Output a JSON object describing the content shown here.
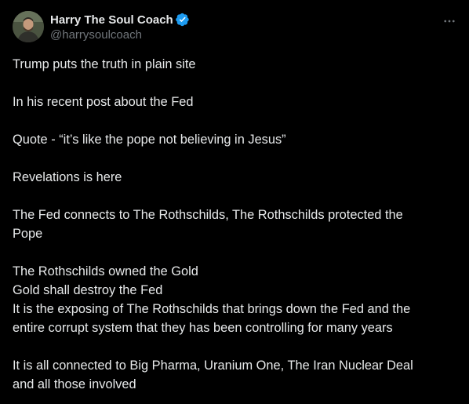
{
  "author": {
    "display_name": "Harry The Soul Coach",
    "handle": "@harrysoulcoach",
    "verified": true,
    "verified_color": "#1d9bf0"
  },
  "actions": {
    "more_icon": "ellipsis-icon"
  },
  "colors": {
    "background": "#000000",
    "primary_text": "#e7e9ea",
    "secondary_text": "#71767b"
  },
  "post": {
    "paragraphs": [
      {
        "lines": [
          "Trump puts the truth in plain site"
        ]
      },
      {
        "lines": [
          "In his recent post about the Fed"
        ]
      },
      {
        "lines": [
          "Quote - “it’s like the pope not believing in Jesus”"
        ]
      },
      {
        "lines": [
          "Revelations is here"
        ]
      },
      {
        "lines": [
          "The Fed connects to The Rothschilds, The Rothschilds protected the",
          "Pope"
        ]
      },
      {
        "lines": [
          "The Rothschilds owned the Gold",
          "Gold shall destroy the Fed",
          "It is the exposing of The Rothschilds that brings down the Fed and the",
          "entire corrupt system that they has been controlling for many years"
        ]
      },
      {
        "lines": [
          "It is all connected to Big Pharma, Uranium One, The Iran Nuclear Deal",
          "and all those involved"
        ]
      }
    ]
  }
}
